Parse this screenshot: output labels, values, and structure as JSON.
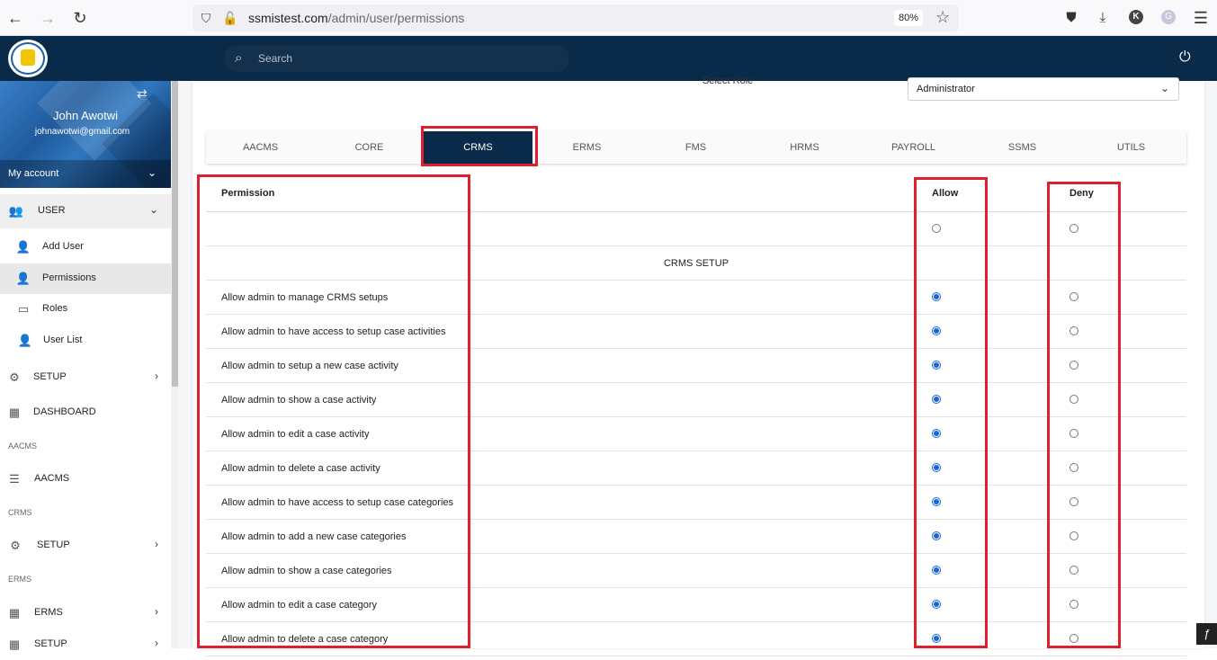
{
  "browser": {
    "url_host": "ssmistest.com",
    "url_path": "/admin/user/permissions",
    "zoom": "80%",
    "profile_initial": "K"
  },
  "topnav": {
    "search_placeholder": "Search"
  },
  "sidebar": {
    "user_name": "John Awotwi",
    "user_email": "johnawotwi@gmail.com",
    "my_account": "My account",
    "user_group": "USER",
    "user_items": [
      {
        "label": "Add User",
        "icon": "add-user-icon"
      },
      {
        "label": "Permissions",
        "icon": "user-key-icon"
      },
      {
        "label": "Roles",
        "icon": "id-card-icon"
      },
      {
        "label": "User List",
        "icon": "user-list-icon"
      }
    ],
    "setup_label": "SETUP",
    "dashboard_label": "DASHBOARD",
    "section_aacms": "AACMS",
    "aacms_label": "AACMS",
    "section_crms": "CRMS",
    "crms_setup_label": "SETUP",
    "section_erms": "ERMS",
    "erms_label": "ERMS",
    "erms_setup_label": "SETUP"
  },
  "role": {
    "label": "Select Role",
    "value": "Administrator"
  },
  "tabs": [
    "AACMS",
    "CORE",
    "CRMS",
    "ERMS",
    "FMS",
    "HRMS",
    "PAYROLL",
    "SSMS",
    "UTILS"
  ],
  "active_tab": "CRMS",
  "table": {
    "col_permission": "Permission",
    "col_allow": "Allow",
    "col_deny": "Deny",
    "section_title": "CRMS SETUP",
    "rows": [
      "Allow admin to manage CRMS setups",
      "Allow admin to have access to setup case activities",
      "Allow admin to setup a new case activity",
      "Allow admin to show a case activity",
      "Allow admin to edit a case activity",
      "Allow admin to delete a case activity",
      "Allow admin to have access to setup case categories",
      "Allow admin to add a new case categories",
      "Allow admin to show a case categories",
      "Allow admin to edit a case category",
      "Allow admin to delete a case category"
    ]
  },
  "colors": {
    "nav": "#0a2a4a",
    "highlight": "#e01f2d",
    "radio_on": "#1565d8"
  }
}
